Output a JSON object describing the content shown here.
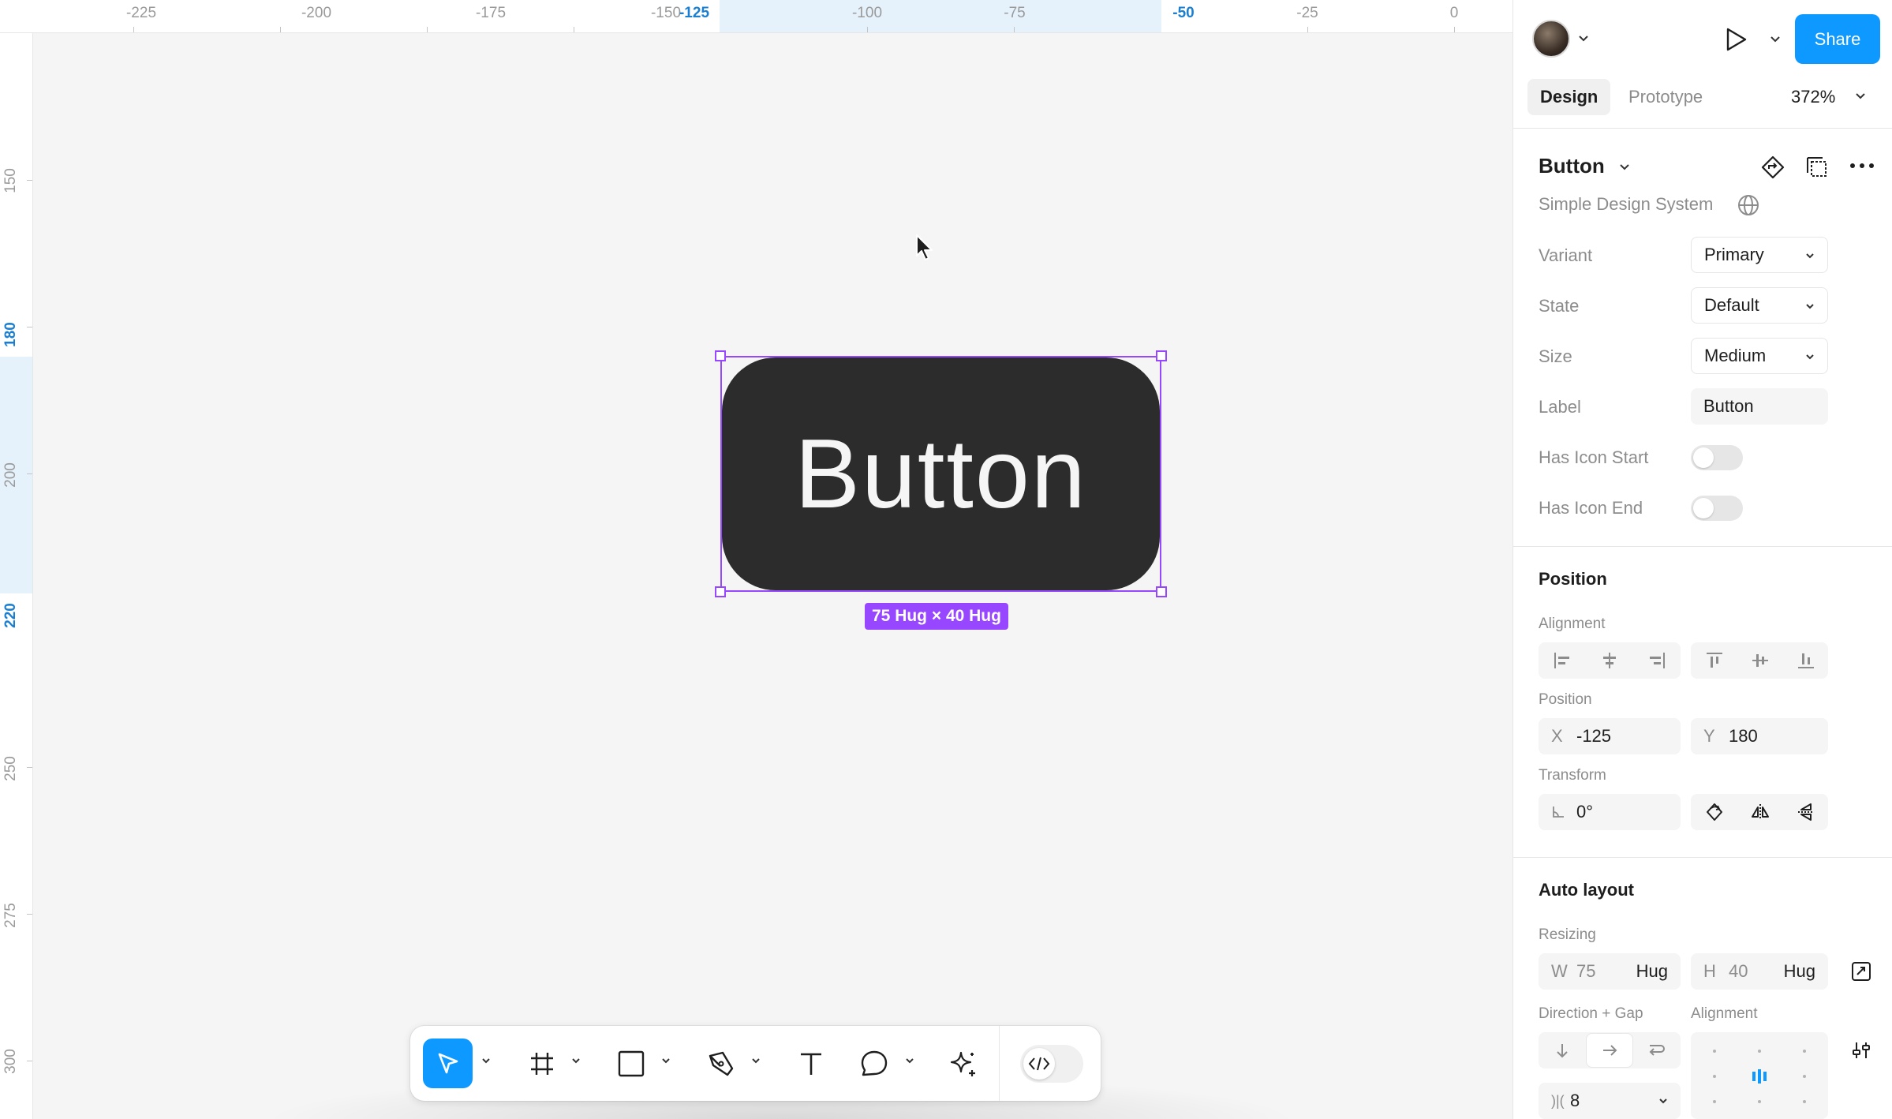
{
  "ruler_top": {
    "ticks": [
      "-225",
      "-200",
      "-175",
      "-150",
      "-125",
      "-100",
      "-75",
      "-50",
      "-25",
      "0"
    ],
    "selected": [
      "-125",
      "-50"
    ]
  },
  "ruler_left": {
    "ticks": [
      "150",
      "180",
      "200",
      "220",
      "250",
      "275",
      "300"
    ],
    "selected": [
      "180",
      "220"
    ]
  },
  "canvas": {
    "component_text": "Button",
    "size_badge": "75 Hug × 40 Hug",
    "selection_color": "#9747ff",
    "component_fill": "#2c2c2c"
  },
  "toolbar": {
    "tools": [
      "move-tool",
      "frame-tool",
      "rectangle-tool",
      "pen-tool",
      "text-tool",
      "comment-tool",
      "actions-tool"
    ],
    "active_tool": "move-tool",
    "accent": "#0d99ff"
  },
  "header": {
    "share_label": "Share",
    "tabs": [
      "Design",
      "Prototype"
    ],
    "active_tab": "Design",
    "zoom": "372%"
  },
  "component": {
    "name": "Button",
    "library": "Simple Design System",
    "properties": [
      {
        "label": "Variant",
        "type": "dropdown",
        "value": "Primary"
      },
      {
        "label": "State",
        "type": "dropdown",
        "value": "Default"
      },
      {
        "label": "Size",
        "type": "dropdown",
        "value": "Medium"
      },
      {
        "label": "Label",
        "type": "text",
        "value": "Button"
      },
      {
        "label": "Has Icon Start",
        "type": "toggle",
        "value": false
      },
      {
        "label": "Has Icon End",
        "type": "toggle",
        "value": false
      }
    ]
  },
  "position": {
    "title": "Position",
    "alignment_label": "Alignment",
    "position_label": "Position",
    "x_prefix": "X",
    "x": "-125",
    "y_prefix": "Y",
    "y": "180",
    "transform_label": "Transform",
    "rotation": "0°"
  },
  "auto_layout": {
    "title": "Auto layout",
    "resizing_label": "Resizing",
    "w_prefix": "W",
    "w": "75",
    "w_mode": "Hug",
    "h_prefix": "H",
    "h": "40",
    "h_mode": "Hug",
    "direction_gap_label": "Direction + Gap",
    "alignment_label": "Alignment",
    "gap": "8"
  }
}
